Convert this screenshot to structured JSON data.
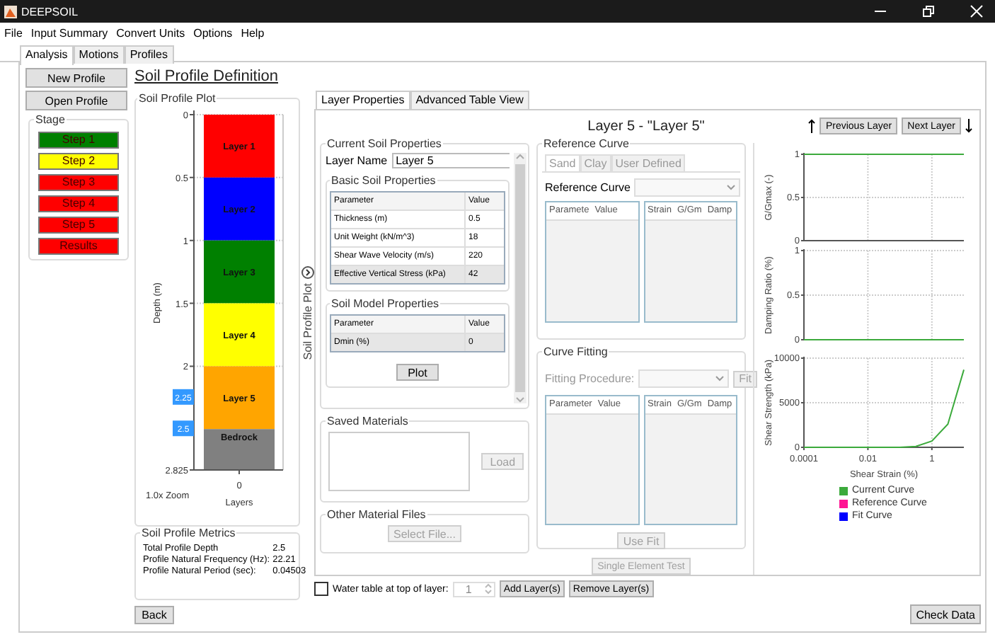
{
  "window": {
    "title": "DEEPSOIL"
  },
  "menu": [
    "File",
    "Input Summary",
    "Convert Units",
    "Options",
    "Help"
  ],
  "tabs": [
    {
      "label": "Analysis",
      "selected": true
    },
    {
      "label": "Motions",
      "selected": false
    },
    {
      "label": "Profiles",
      "selected": false
    }
  ],
  "sidebar": {
    "buttons": [
      {
        "label": "New Profile"
      },
      {
        "label": "Open Profile"
      }
    ],
    "stage": {
      "title": "Stage",
      "steps": [
        {
          "label": "Step 1",
          "color": "#008000"
        },
        {
          "label": "Step 2",
          "color": "#ffff00"
        },
        {
          "label": "Step 3",
          "color": "#ff0000"
        },
        {
          "label": "Step 4",
          "color": "#ff0000"
        },
        {
          "label": "Step 5",
          "color": "#ff0000"
        },
        {
          "label": "Results",
          "color": "#ff0000"
        }
      ]
    }
  },
  "heading": "Soil Profile Definition",
  "profile_plot": {
    "title": "Soil Profile Plot",
    "chart_data": {
      "type": "bar",
      "stacked": true,
      "orientation": "vertical",
      "grid": true,
      "xlabel": "Layers",
      "ylabel": "Depth (m)",
      "categories": [
        "0"
      ],
      "ylim": [
        2.825,
        0
      ],
      "yticks": [
        0,
        0.5,
        1,
        1.5,
        2,
        2.825
      ],
      "series": [
        {
          "name": "Layer 1",
          "color": "#ff0000",
          "values": [
            0.5
          ]
        },
        {
          "name": "Layer 2",
          "color": "#0000ff",
          "values": [
            0.5
          ]
        },
        {
          "name": "Layer 3",
          "color": "#008000",
          "values": [
            0.5
          ]
        },
        {
          "name": "Layer 4",
          "color": "#ffff00",
          "values": [
            0.5
          ]
        },
        {
          "name": "Layer 5",
          "color": "#ffa500",
          "values": [
            0.5
          ]
        }
      ]
    },
    "bedrock": {
      "label": "Bedrock",
      "color": "#808080"
    },
    "markers": [
      "2.25",
      "2.5"
    ],
    "zoom": "1.0x Zoom"
  },
  "collapse_label": "Soil Profile Plot",
  "metrics": {
    "title": "Soil Profile Metrics",
    "rows": [
      {
        "label": "Total Profile Depth",
        "value": "2.5"
      },
      {
        "label": "Profile Natural Frequency (Hz):",
        "value": "22.21"
      },
      {
        "label": "Profile Natural Period (sec):",
        "value": "0.04503"
      }
    ]
  },
  "back_button": {
    "label": "Back"
  },
  "layer_tabs": [
    {
      "label": "Layer Properties",
      "selected": true
    },
    {
      "label": "Advanced Table View",
      "selected": false
    }
  ],
  "layer_title": "Layer 5 - \"Layer 5\"",
  "nav_buttons": [
    {
      "label": "Previous Layer"
    },
    {
      "label": "Next Layer"
    }
  ],
  "current_props": {
    "title": "Current Soil Properties",
    "layer_name_label": "Layer Name",
    "layer_name": "Layer 5",
    "basic": {
      "title": "Basic Soil Properties",
      "columns": [
        "Parameter",
        "Value"
      ],
      "rows": [
        {
          "cells": [
            "Thickness (m)",
            "0.5"
          ],
          "selected": false
        },
        {
          "cells": [
            "Unit Weight (kN/m^3)",
            "18"
          ],
          "selected": false
        },
        {
          "cells": [
            "Shear Wave Velocity (m/s)",
            "220"
          ],
          "selected": false
        },
        {
          "cells": [
            "Effective Vertical Stress (kPa)",
            "42"
          ],
          "selected": true
        }
      ]
    },
    "model": {
      "title": "Soil Model Properties",
      "columns": [
        "Parameter",
        "Value"
      ],
      "rows": [
        {
          "cells": [
            "Dmin (%)",
            "0"
          ],
          "selected": true
        }
      ]
    },
    "plot_button": {
      "label": "Plot"
    }
  },
  "saved_materials": {
    "title": "Saved Materials",
    "load_button": {
      "label": "Load",
      "disabled": true
    }
  },
  "other_files": {
    "title": "Other Material Files",
    "button": {
      "label": "Select File...",
      "disabled": true
    }
  },
  "reference_curve": {
    "title": "Reference Curve",
    "tabs": [
      {
        "label": "Sand",
        "selected": true
      },
      {
        "label": "Clay",
        "selected": false
      },
      {
        "label": "User Defined",
        "selected": false
      }
    ],
    "dropdown_label": "Reference Curve",
    "tables": [
      [
        "Paramete",
        "Value"
      ],
      [
        "Strain",
        "G/Gm",
        "Damp"
      ]
    ]
  },
  "curve_fitting": {
    "title": "Curve Fitting",
    "dropdown_label": "Fitting Procedure:",
    "fit_button": {
      "label": "Fit",
      "disabled": true
    },
    "tables": [
      [
        "Parameter",
        "Value"
      ],
      [
        "Strain",
        "G/Gm",
        "Damp"
      ]
    ],
    "use_fit_button": {
      "label": "Use Fit",
      "disabled": true
    }
  },
  "single_element_button": {
    "label": "Single Element Test",
    "disabled": true
  },
  "curve_charts": [
    {
      "chart_data": {
        "type": "line",
        "grid": true,
        "ylabel": "G/Gmax (-)",
        "categories": [
          null,
          null,
          null,
          null,
          null,
          null,
          null,
          null,
          null,
          null,
          null
        ],
        "ylim": [
          0,
          1
        ],
        "yticks": [
          0,
          0.5,
          1
        ],
        "series": [
          {
            "color": "#3caa3c",
            "values": [
              1,
              1,
              1,
              1,
              1,
              1,
              1,
              1,
              1,
              1,
              1
            ]
          }
        ]
      }
    },
    {
      "chart_data": {
        "type": "line",
        "grid": true,
        "ylabel": "Damping Ratio (%)",
        "categories": [
          null,
          null,
          null,
          null,
          null,
          null,
          null,
          null,
          null,
          null,
          null
        ],
        "ylim": [
          0,
          1
        ],
        "yticks": [
          0,
          0.5,
          1
        ],
        "series": [
          {
            "color": "#3caa3c",
            "values": [
              0,
              0,
              0,
              0,
              0,
              0,
              0,
              0,
              0,
              0,
              0
            ]
          }
        ]
      }
    },
    {
      "chart_data": {
        "type": "line",
        "grid": true,
        "ylabel": "Shear Strength (kPa)",
        "xlabel": "Shear Strain (%)",
        "categories": [
          "0.0001",
          null,
          null,
          null,
          "0.01",
          null,
          null,
          null,
          "1",
          null,
          null
        ],
        "ylim": [
          0,
          10000
        ],
        "yticks": [
          0,
          5000,
          10000
        ],
        "series": [
          {
            "name": "Current Curve",
            "color": "#3caa3c",
            "values": [
              0,
              0,
              0,
              0,
              0,
              0,
              0,
              100,
              700,
              2600,
              8700
            ]
          },
          {
            "name": "Reference Curve",
            "color": "#ff1493",
            "values": [
              null,
              null,
              null,
              null,
              null,
              null,
              null,
              null,
              null,
              null,
              null
            ]
          },
          {
            "name": "Fit Curve",
            "color": "#0000ff",
            "values": [
              null,
              null,
              null,
              null,
              null,
              null,
              null,
              null,
              null,
              null,
              null
            ]
          }
        ]
      }
    }
  ],
  "water_table": {
    "label": "Water table at top of layer:",
    "checked": false,
    "value": "1",
    "disabled": true
  },
  "layer_buttons": [
    {
      "label": "Add Layer(s)"
    },
    {
      "label": "Remove Layer(s)"
    }
  ],
  "check_button": {
    "label": "Check Data"
  }
}
